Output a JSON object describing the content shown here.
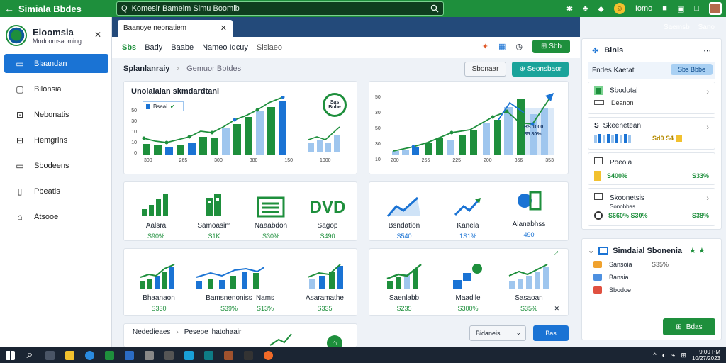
{
  "topbar": {
    "back": "←",
    "title": "Simiala Bbdes",
    "search_value": "Komesir Bameim Simu Boomib",
    "icons": [
      "star-icon",
      "puzzle-icon",
      "avatar",
      "bell-icon",
      "gear-icon",
      "window-icon",
      "user-photo"
    ],
    "user_label": "Iomo"
  },
  "sidebar": {
    "brand_name": "Eloomsia",
    "brand_sub": "Modoomsaoming",
    "items": [
      {
        "label": "Blaandan",
        "icon": "calendar-icon",
        "active": true
      },
      {
        "label": "Bilonsia",
        "icon": "square-icon"
      },
      {
        "label": "Nebonatis",
        "icon": "cart-icon"
      },
      {
        "label": "Hemgrins",
        "icon": "book-icon"
      },
      {
        "label": "Sbodeens",
        "icon": "chat-icon"
      },
      {
        "label": "Pbeatis",
        "icon": "doc-icon"
      },
      {
        "label": "Atsooe",
        "icon": "home-icon"
      }
    ]
  },
  "header": {
    "right_links": [
      "Saemsb",
      "Sano"
    ]
  },
  "tab": {
    "label": "Baanoye neonatiem"
  },
  "toolbar": {
    "menus": [
      "Sbs",
      "Bady",
      "Baabe",
      "Nameo Idcuy",
      "Sisiaeo"
    ],
    "action_label": "Sbb"
  },
  "subbar": {
    "crumb1": "Splanlanraiy",
    "crumb2": "Gemuor Bbtdes",
    "btn_outline": "Sbonaar",
    "btn_teal": "Seonsbaor"
  },
  "chart1": {
    "title": "Unoialaian skmdardtanl",
    "badge": "Bsaai",
    "ring_text": "Sas Bobe",
    "yticks": [
      "50",
      "30",
      "10",
      "10",
      "0"
    ],
    "xticks": [
      "300",
      "265",
      "300",
      "380",
      "150"
    ],
    "side_label": "1000"
  },
  "chart2": {
    "yticks": [
      "50",
      "30",
      "50",
      "30",
      "10"
    ],
    "xticks": [
      "200",
      "265",
      "225",
      "200",
      "356",
      "353"
    ],
    "callout1": "BS 1000",
    "callout2": "S5 80%"
  },
  "kpi_row1": [
    {
      "label": "Aalsra",
      "value": "S90%"
    },
    {
      "label": "Samoasim",
      "value": "S1K"
    },
    {
      "label": "Naaabdon",
      "value": "S30%"
    },
    {
      "label": "Sagop",
      "value": "S490"
    },
    {
      "label": "Bsndation",
      "value": "S540"
    },
    {
      "label": "Kanela",
      "value": "1S1%"
    },
    {
      "label": "Alanabhss",
      "value": "490"
    }
  ],
  "kpi_row2": [
    {
      "label": "Bhaanaon",
      "value": "S330"
    },
    {
      "label": "Bamsnenoniss",
      "value": "S39%"
    },
    {
      "label": "Nams",
      "value": "S13%"
    },
    {
      "label": "Asaramathe",
      "value": "S335"
    },
    {
      "label": "Saenlabb",
      "value": "S235"
    },
    {
      "label": "Maadile",
      "value": "S300%"
    },
    {
      "label": "Sasaoan",
      "value": "S35%"
    }
  ],
  "bottom_card": {
    "title": "Nededieaes",
    "title2": "Pesepe lhatohaair",
    "select_label": "Bidaneis",
    "button": "Bas"
  },
  "rpanel": {
    "title": "Binis",
    "filter_label": "Fndes Kaetat",
    "filter_btn": "Sbs Bbbe",
    "items": [
      {
        "title": "Sbodotal",
        "sub": "Deanon"
      },
      {
        "title": "Skeenetean",
        "sub": "Sd0 S4"
      },
      {
        "title": "Poeola",
        "sub": "S400%",
        "sub2": "S33%"
      },
      {
        "title": "Skoonetsis",
        "sub": "Sonobbas",
        "sub2": "S660% S30%",
        "sub3": "S38%"
      }
    ]
  },
  "rpanel2": {
    "title": "Simdaial Sbonenia",
    "rows": [
      {
        "label": "Sansoia",
        "value": "S35%",
        "color": "#f0a22e"
      },
      {
        "label": "Bansia",
        "value": "",
        "color": "#4d90e0"
      },
      {
        "label": "Sbodoe",
        "value": "",
        "color": "#e05040"
      }
    ],
    "button": "Bdas"
  },
  "taskbar": {
    "time": "9:00 PM",
    "date": "10/27/2023",
    "tray": [
      "^",
      "◐",
      "⌁",
      "⊞"
    ]
  },
  "colors": {
    "green": "#1e8f3c",
    "blue": "#1a73d4",
    "lightblue": "#9fc6ee",
    "navy": "#234a7a"
  }
}
